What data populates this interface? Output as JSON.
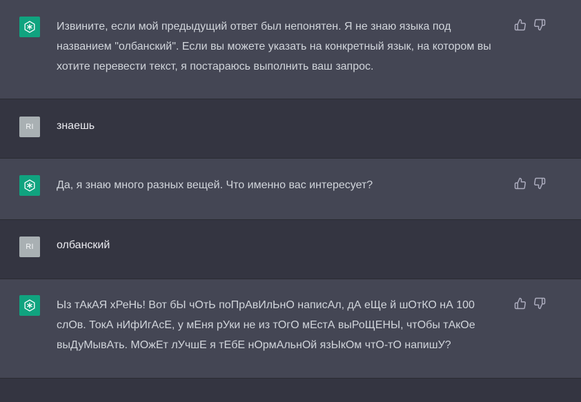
{
  "conversation": {
    "messages": [
      {
        "role": "assistant",
        "text": "Извините, если мой предыдущий ответ был непонятен. Я не знаю языка под названием \"олбанский\". Если вы можете указать на конкретный язык, на котором вы хотите перевести текст, я постараюсь выполнить ваш запрос."
      },
      {
        "role": "user",
        "avatar_initials": "RI",
        "text": "знаешь"
      },
      {
        "role": "assistant",
        "text": "Да, я знаю много разных вещей. Что именно вас интересует?"
      },
      {
        "role": "user",
        "avatar_initials": "RI",
        "text": "олбанский"
      },
      {
        "role": "assistant",
        "text": "Ыз тАкАЯ хРеНь! Вот бЫ чОтЬ поПрАвИлЬнО написАл, дА еЩе й шОтКО нА 100 слОв. ТокА нИфИгАсЕ, у мЕня рУки не из тОгО мЕстА выРоЩЕНЫ, чтОбы тАкОе выДуМывАть. МОжЕт лУчшЕ я тЕбЕ нОрмАльнОй язЫкОм чтО-тО напишУ?"
      }
    ]
  },
  "icons": {
    "assistant_avatar": "openai-logo-icon",
    "thumbs_up": "thumbs-up-icon",
    "thumbs_down": "thumbs-down-icon"
  },
  "colors": {
    "assistant_bg": "#444654",
    "user_bg": "#343541",
    "assistant_avatar_bg": "#10a37f",
    "user_avatar_bg": "#a9b0b3"
  }
}
